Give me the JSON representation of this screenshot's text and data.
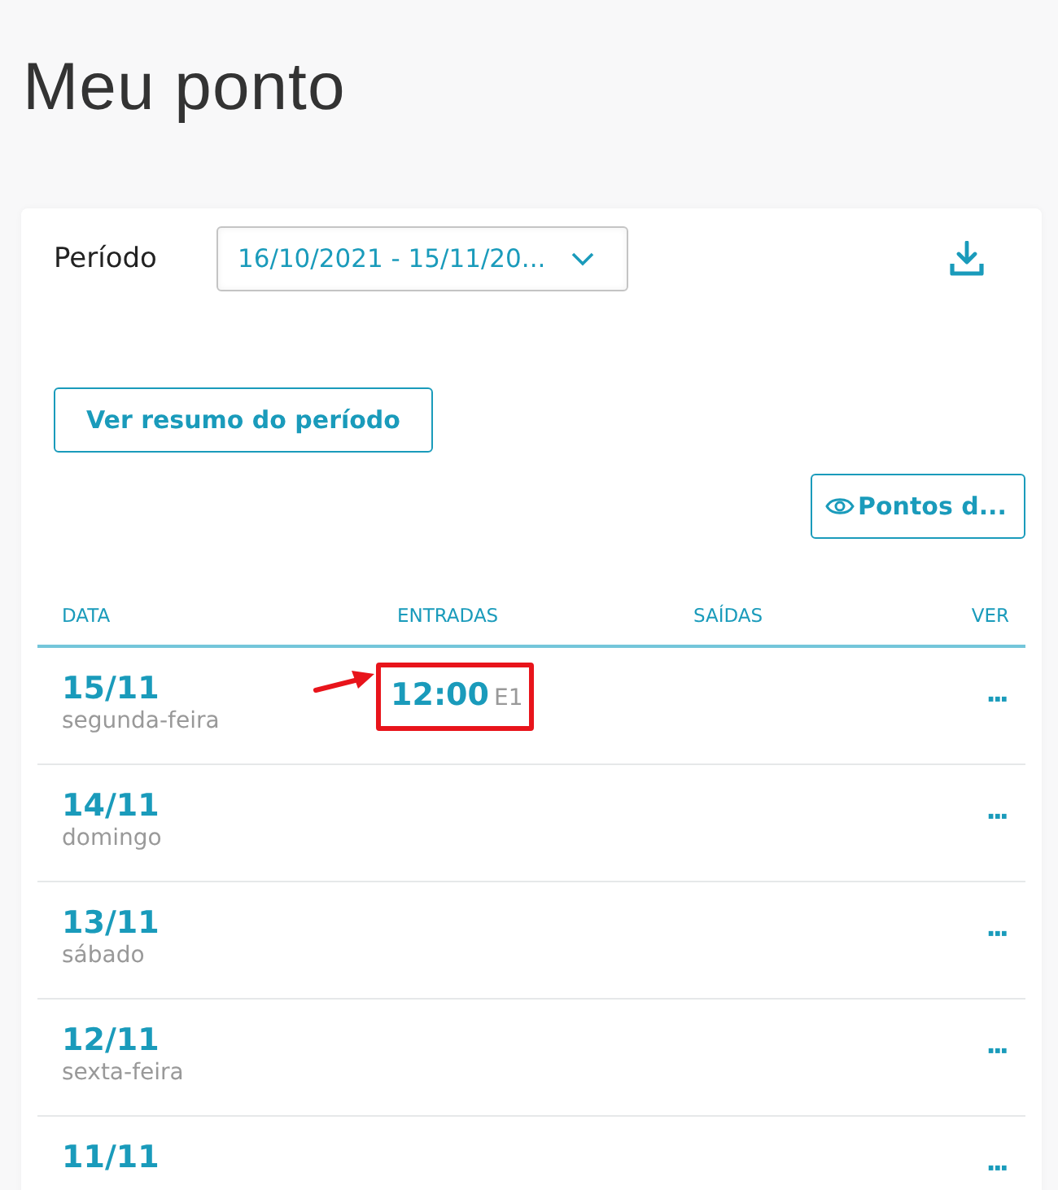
{
  "page_title": "Meu ponto",
  "period": {
    "label": "Período",
    "value": "16/10/2021 - 15/11/20..."
  },
  "buttons": {
    "summary": "Ver resumo do período",
    "points": "Pontos d..."
  },
  "table": {
    "columns": [
      "DATA",
      "ENTRADAS",
      "SAÍDAS",
      "VER"
    ],
    "rows": [
      {
        "date": "15/11",
        "weekday": "segunda-feira",
        "entries": [
          {
            "time": "12:00",
            "code": "E1",
            "highlighted": true
          }
        ],
        "more": "···"
      },
      {
        "date": "14/11",
        "weekday": "domingo",
        "entries": [],
        "more": "···"
      },
      {
        "date": "13/11",
        "weekday": "sábado",
        "entries": [],
        "more": "···"
      },
      {
        "date": "12/11",
        "weekday": "sexta-feira",
        "entries": [],
        "more": "···"
      },
      {
        "date": "11/11",
        "entries": [],
        "more": "···"
      }
    ]
  }
}
